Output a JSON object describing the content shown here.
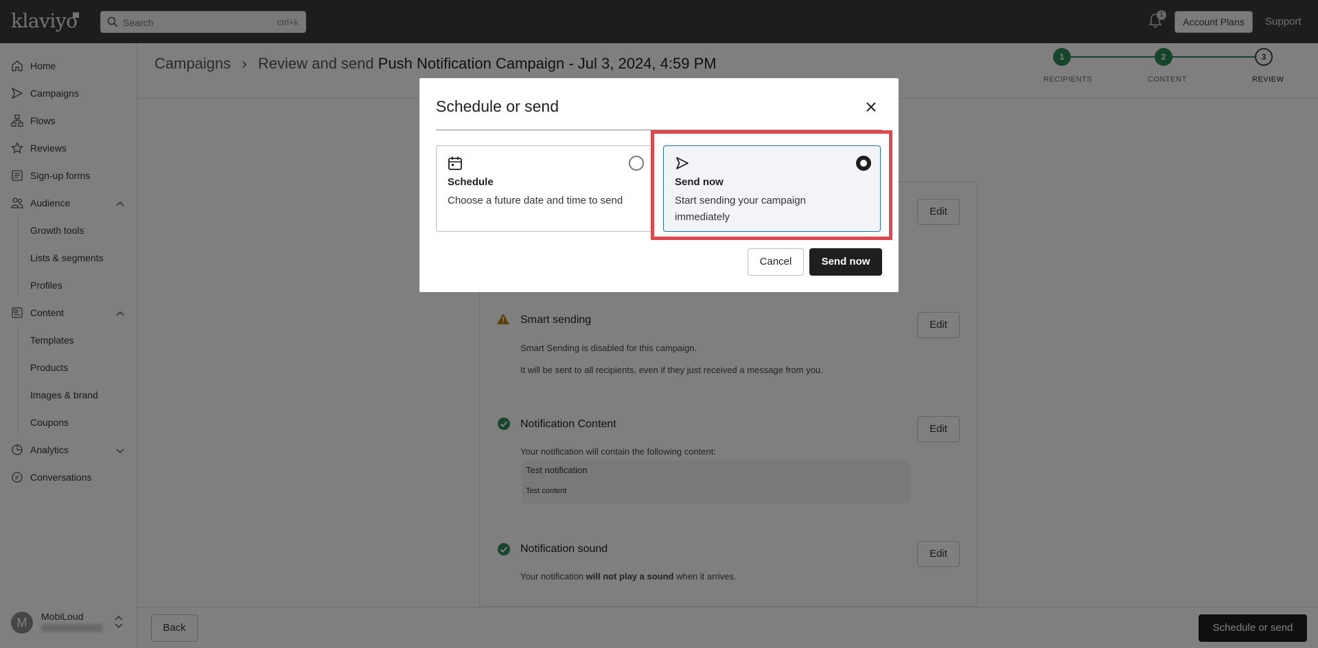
{
  "topbar": {
    "logo": "klaviyo",
    "search_placeholder": "Search",
    "search_shortcut": "ctrl+k",
    "notifications_count": "1",
    "account_plans": "Account Plans",
    "support": "Support"
  },
  "sidebar": {
    "items": [
      {
        "label": "Home",
        "icon": "home-icon"
      },
      {
        "label": "Campaigns",
        "icon": "send-icon"
      },
      {
        "label": "Flows",
        "icon": "flows-icon"
      },
      {
        "label": "Reviews",
        "icon": "star-icon"
      },
      {
        "label": "Sign-up forms",
        "icon": "form-icon"
      },
      {
        "label": "Audience",
        "icon": "people-icon"
      },
      {
        "label": "Growth tools"
      },
      {
        "label": "Lists & segments"
      },
      {
        "label": "Profiles"
      },
      {
        "label": "Content",
        "icon": "content-icon"
      },
      {
        "label": "Templates"
      },
      {
        "label": "Products"
      },
      {
        "label": "Images & brand"
      },
      {
        "label": "Coupons"
      },
      {
        "label": "Analytics",
        "icon": "analytics-icon"
      },
      {
        "label": "Conversations",
        "icon": "chat-icon"
      }
    ],
    "user": {
      "initial": "M",
      "name": "MobiLoud"
    }
  },
  "header": {
    "breadcrumb_root": "Campaigns",
    "breadcrumb_prefix": "Review and send",
    "campaign_name": "Push Notification Campaign - Jul 3, 2024, 4:59 PM"
  },
  "stepper": {
    "steps": [
      {
        "number": "1",
        "label": "RECIPIENTS",
        "state": "done"
      },
      {
        "number": "2",
        "label": "CONTENT",
        "state": "done"
      },
      {
        "number": "3",
        "label": "REVIEW",
        "state": "current"
      }
    ]
  },
  "review": {
    "edit_label": "Edit",
    "smart_sending": {
      "title": "Smart sending",
      "line1": "Smart Sending is disabled for this campaign.",
      "line2": "It will be sent to all recipients, even if they just received a message from you."
    },
    "notification_content": {
      "title": "Notification Content",
      "intro": "Your notification will contain the following content:",
      "content_title": "Test notification",
      "content_body": "Test content"
    },
    "notification_sound": {
      "title": "Notification sound",
      "text_before": "Your notification ",
      "text_bold": "will not play a sound",
      "text_after": " when it arrives."
    }
  },
  "footer": {
    "back": "Back",
    "schedule_or_send": "Schedule or send"
  },
  "modal": {
    "title": "Schedule or send",
    "options": [
      {
        "title": "Schedule",
        "description": "Choose a future date and time to send",
        "selected": false
      },
      {
        "title": "Send now",
        "description": "Start sending your campaign immediately",
        "selected": true
      }
    ],
    "cancel": "Cancel",
    "send_now": "Send now",
    "highlight_color": "#e0474c"
  }
}
